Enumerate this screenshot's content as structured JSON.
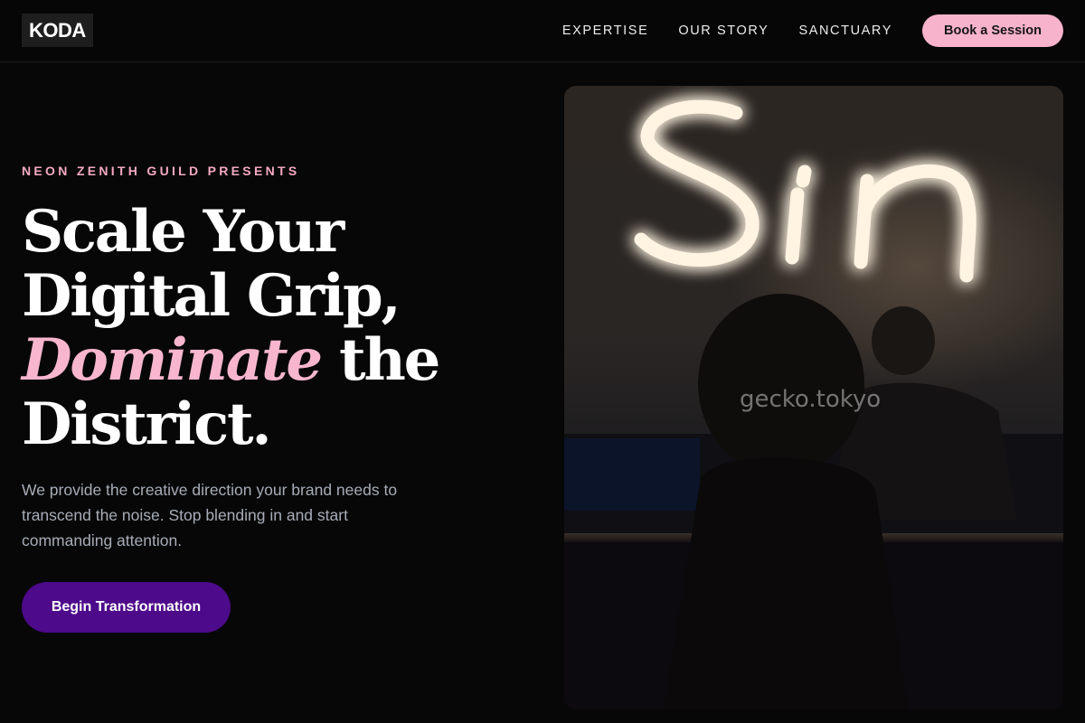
{
  "header": {
    "logo": "KODA",
    "nav": [
      "EXPERTISE",
      "OUR STORY",
      "SANCTUARY"
    ],
    "cta": "Book a Session"
  },
  "hero": {
    "eyebrow": "NEON ZENITH GUILD PRESENTS",
    "headline_line1": "Scale Your",
    "headline_line2": "Digital Grip,",
    "headline_accent": "Dominate",
    "headline_line3_rest": " the",
    "headline_line4": "District.",
    "description": "We provide the creative direction your brand needs to transcend the noise. Stop blending in and start commanding attention.",
    "cta": "Begin Transformation"
  },
  "image": {
    "neon_text": "Sin",
    "watermark": "gecko.tokyo"
  },
  "colors": {
    "accent_pink": "#f7b3cc",
    "cta_purple": "#4d0a8a",
    "background": "#070707"
  }
}
